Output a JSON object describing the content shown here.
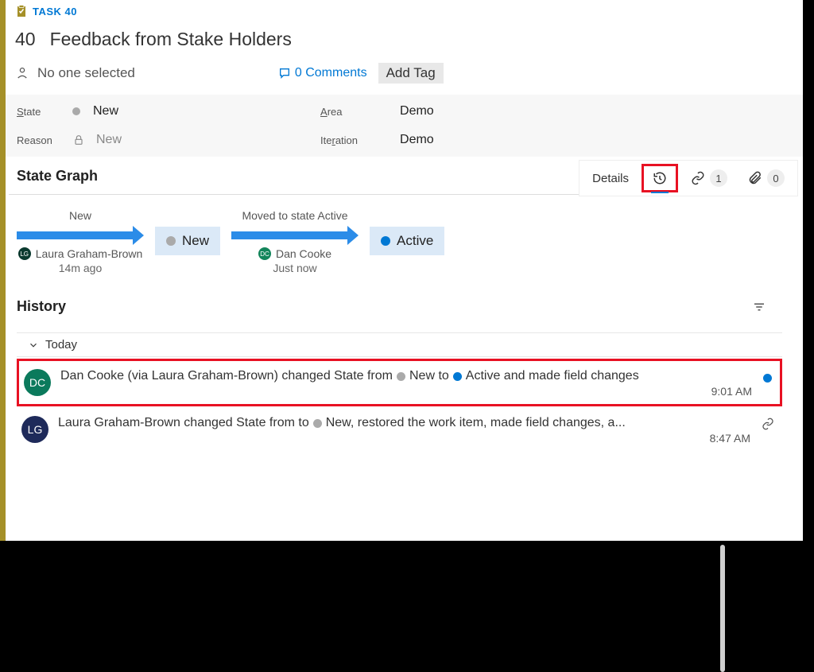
{
  "header": {
    "type_label": "TASK 40",
    "id": "40",
    "title": "Feedback from Stake Holders",
    "assigned": "No one selected",
    "comments_count": "0 Comments",
    "add_tag": "Add Tag"
  },
  "fields": {
    "state_label": "State",
    "state_value": "New",
    "reason_label": "Reason",
    "reason_value": "New",
    "area_label": "Area",
    "area_value": "Demo",
    "iteration_label": "Iteration",
    "iteration_value": "Demo"
  },
  "tabs": {
    "details": "Details",
    "links_count": "1",
    "attachments_count": "0"
  },
  "state_graph": {
    "section_title": "State Graph",
    "node1_top": "New",
    "node1_state": "New",
    "node1_user": "Laura Graham-Brown",
    "node1_time": "14m ago",
    "node1_avatar": "LG",
    "node2_top": "Moved to state Active",
    "node2_state": "Active",
    "node2_user": "Dan Cooke",
    "node2_time": "Just now",
    "node2_avatar": "DC"
  },
  "history": {
    "section_title": "History",
    "group": "Today",
    "entry1": {
      "avatar": "DC",
      "t1": "Dan Cooke (via Laura Graham-Brown) changed State from",
      "t2": "New to",
      "t3": "Active and made field changes",
      "time": "9:01 AM"
    },
    "entry2": {
      "avatar": "LG",
      "t1": "Laura Graham-Brown changed State from to",
      "t2": "New, restored the work item, made field changes, a...",
      "time": "8:47 AM"
    }
  }
}
